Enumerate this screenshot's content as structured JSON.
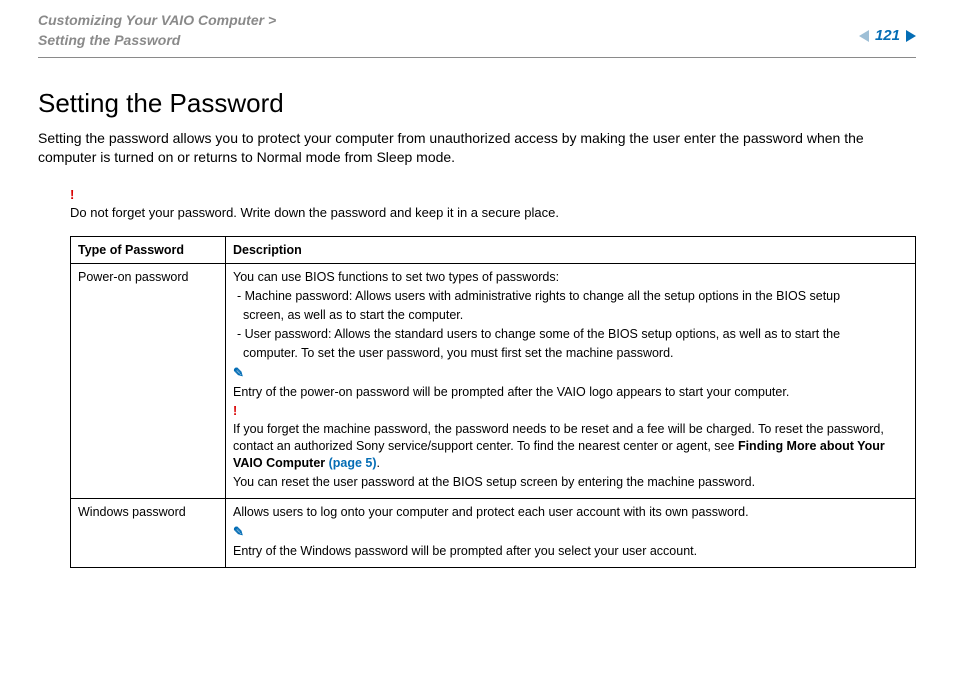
{
  "breadcrumb": {
    "section": "Customizing Your VAIO Computer",
    "gt": ">",
    "page": "Setting the Password"
  },
  "pagenum": "121",
  "title": "Setting the Password",
  "intro": "Setting the password allows you to protect your computer from unauthorized access by making the user enter the password when the computer is turned on or returns to Normal mode from Sleep mode.",
  "bang": "!",
  "top_warn": "Do not forget your password. Write down the password and keep it in a secure place.",
  "note_icon": "✎",
  "headers": {
    "c1": "Type of Password",
    "c2": "Description"
  },
  "row1": {
    "type": "Power-on password",
    "l1": "You can use BIOS functions to set two types of passwords:",
    "l2a": "- Machine password: Allows users with administrative rights to change all the setup options in the BIOS setup",
    "l2b": "screen, as well as to start the computer.",
    "l3a": "- User password: Allows the standard users to change some of the BIOS setup options, as well as to start the",
    "l3b": "computer. To set the user password, you must first set the machine password.",
    "note": "Entry of the power-on password will be prompted after the VAIO logo appears to start your computer.",
    "warn1": "If you forget the machine password, the password needs to be reset and a fee will be charged. To reset the password, contact an authorized Sony service/support center. To find the nearest center or agent, see ",
    "warn1b": "Finding More about Your VAIO Computer ",
    "warn1link": "(page 5)",
    "warn1dot": ".",
    "warn2": "You can reset the user password at the BIOS setup screen by entering the machine password."
  },
  "row2": {
    "type": "Windows password",
    "l1": "Allows users to log onto your computer and protect each user account with its own password.",
    "note": "Entry of the Windows password will be prompted after you select your user account."
  }
}
